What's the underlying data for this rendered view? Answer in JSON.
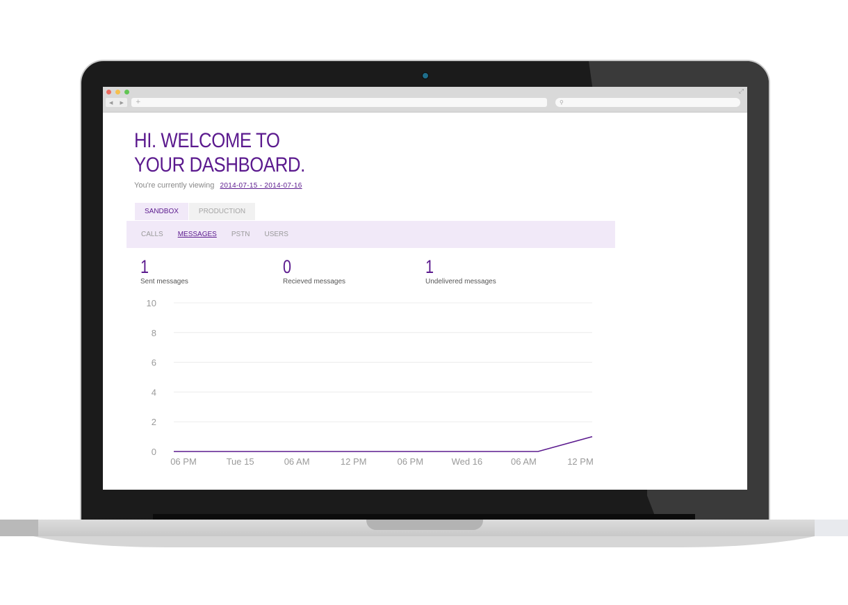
{
  "browser": {
    "url_text": "+",
    "search_icon": "search-icon",
    "nav_back": "◀",
    "nav_forward": "▶"
  },
  "page": {
    "title_line1": "HI. WELCOME TO",
    "title_line2": "YOUR DASHBOARD.",
    "viewing_label": "You're currently viewing",
    "date_range": "2014-07-15 - 2014-07-16"
  },
  "env_tabs": [
    {
      "label": "SANDBOX",
      "active": true
    },
    {
      "label": "PRODUCTION",
      "active": false
    }
  ],
  "subnav": [
    {
      "label": "CALLS",
      "active": false
    },
    {
      "label": "MESSAGES",
      "active": true
    },
    {
      "label": "PSTN",
      "active": false
    },
    {
      "label": "USERS",
      "active": false
    }
  ],
  "stats": [
    {
      "value": "1",
      "label": "Sent messages"
    },
    {
      "value": "0",
      "label": "Recieved messages"
    },
    {
      "value": "1",
      "label": "Undelivered messages"
    }
  ],
  "colors": {
    "accent": "#5b1a8e",
    "nav_bg": "#f1e9f8"
  },
  "chart_data": {
    "type": "line",
    "x": [
      "06 PM",
      "Tue 15",
      "06 AM",
      "12 PM",
      "06 PM",
      "Wed 16",
      "06 AM",
      "12 PM"
    ],
    "ylim": [
      0,
      10
    ],
    "yticks": [
      0,
      2,
      4,
      6,
      8,
      10
    ],
    "grid": true,
    "series": [
      {
        "values": [
          0,
          0,
          0,
          0,
          0,
          0,
          0,
          0,
          1
        ]
      }
    ]
  }
}
